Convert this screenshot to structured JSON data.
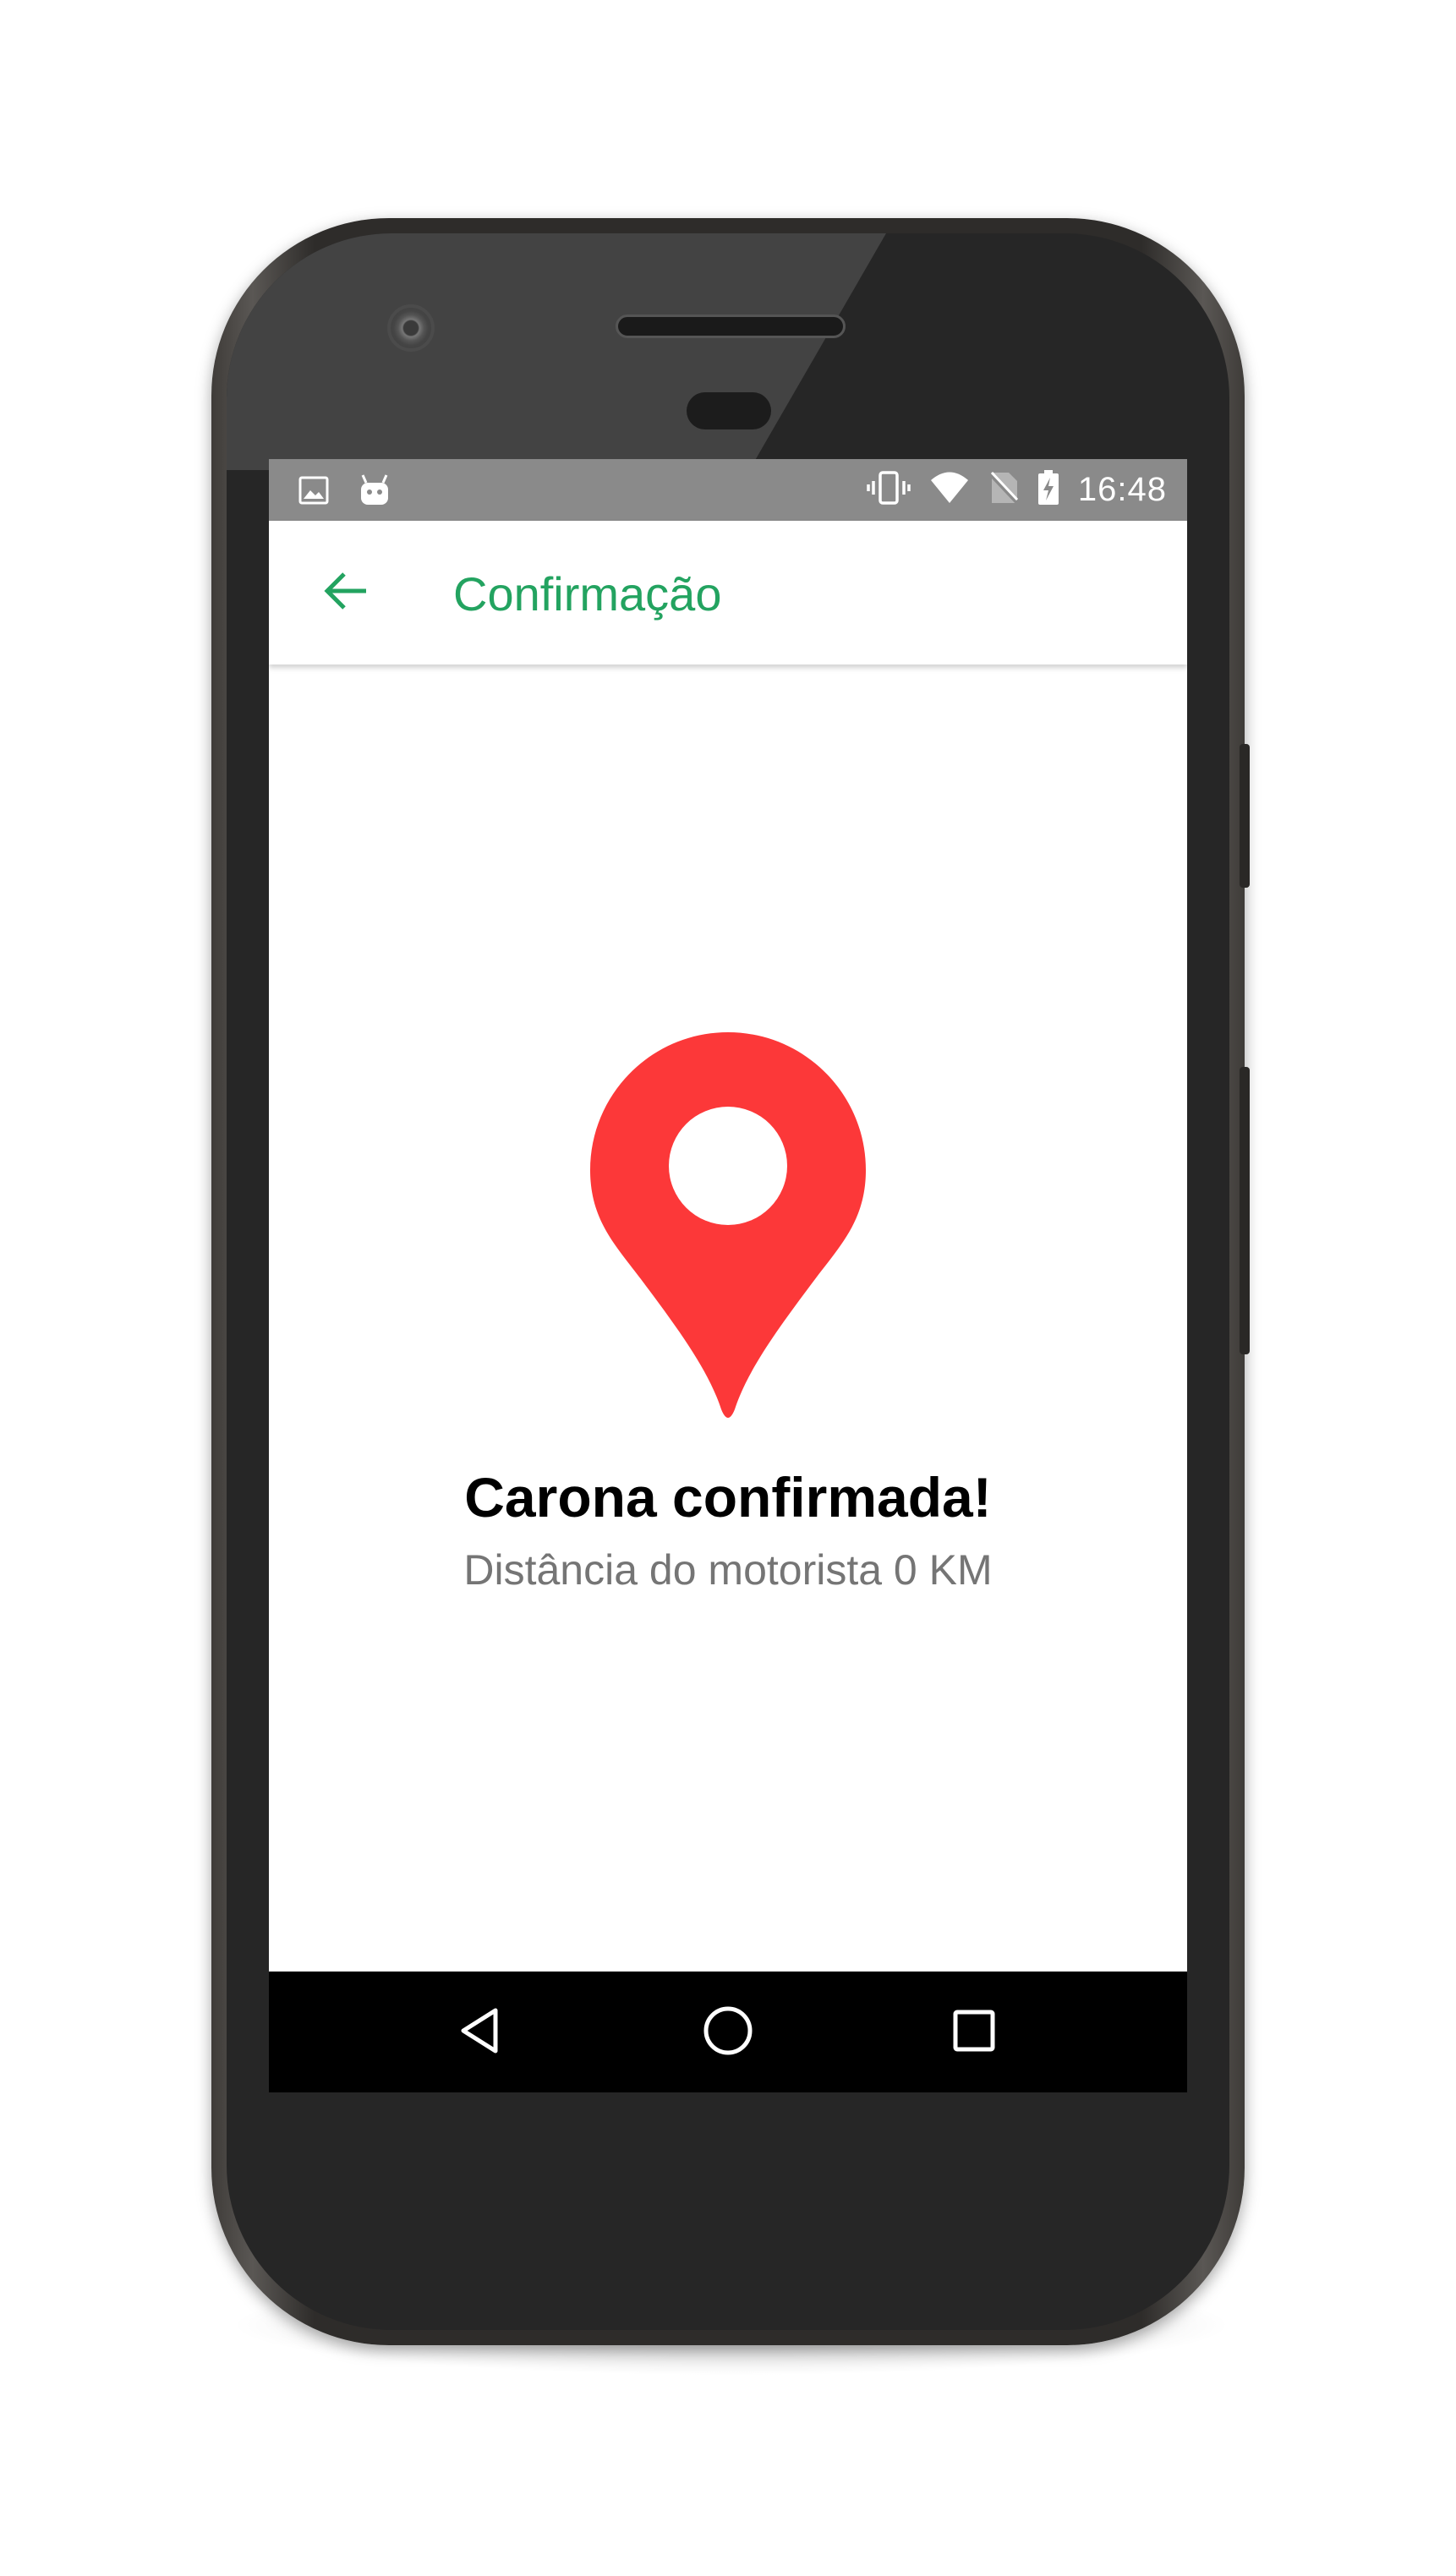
{
  "status_bar": {
    "time": "16:48",
    "left_icons": [
      "image-notification-icon",
      "android-notification-icon"
    ],
    "right_icons": [
      "vibrate-icon",
      "wifi-icon",
      "no-sim-icon",
      "battery-charging-icon"
    ]
  },
  "app_bar": {
    "back_icon": "arrow-left-icon",
    "title": "Confirmação"
  },
  "main": {
    "icon": "location-pin-icon",
    "title": "Carona confirmada!",
    "subtitle": "Distância do motorista 0 KM"
  },
  "nav_bar": {
    "buttons": [
      "back-triangle-icon",
      "home-circle-icon",
      "recents-square-icon"
    ]
  },
  "colors": {
    "accent": "#23a360",
    "pin": "#fc3839",
    "status_bar": "#8a8a8a",
    "subtitle": "#757575",
    "nav_bar": "#000000"
  }
}
